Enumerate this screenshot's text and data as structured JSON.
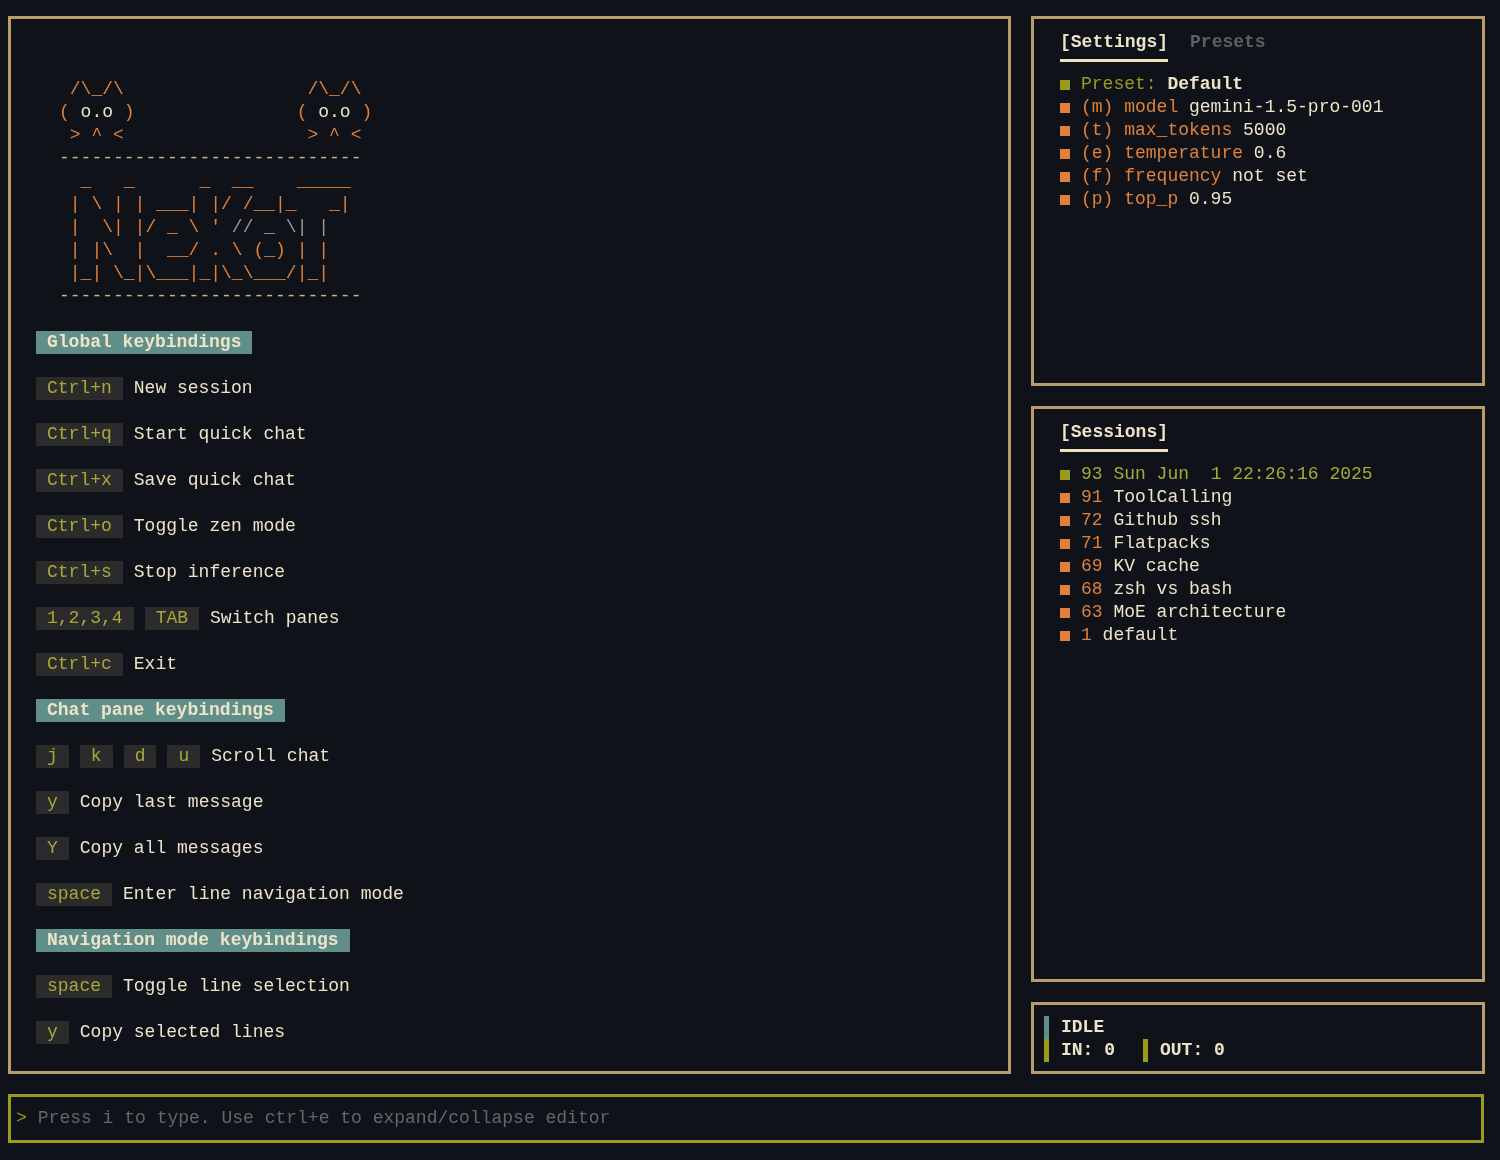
{
  "help_pane": {
    "art": {
      "color": "#e0803a",
      "lines": [
        {
          "segments": [
            {
              "text": " /\\_/\\                 /\\_/\\",
              "color": "#e0803a"
            }
          ]
        },
        {
          "segments": [
            {
              "text": "( ",
              "color": "#e0803a"
            },
            {
              "text": "o.o",
              "color": "#ece3c9"
            },
            {
              "text": " )               ( ",
              "color": "#e0803a"
            },
            {
              "text": "o.o",
              "color": "#ece3c9"
            },
            {
              "text": " )",
              "color": "#e0803a"
            }
          ]
        },
        {
          "segments": [
            {
              "text": " > ^ <                 > ^ <",
              "color": "#e0803a"
            }
          ]
        },
        {
          "segments": [
            {
              "text": "----------------------------",
              "color": "#c7b48a"
            }
          ]
        },
        {
          "segments": [
            {
              "text": "  _   _      _  __    _____"
            }
          ]
        },
        {
          "segments": [
            {
              "text": " | \\ | | ___| |/ /__|_   _|",
              "color": "#e0803a"
            }
          ]
        },
        {
          "segments": [
            {
              "text": " |  \\| |/ _ \\ ' ",
              "color": "#e0803a"
            },
            {
              "text": "// _ \\| |",
              "color": "#9a9a9a"
            }
          ]
        },
        {
          "segments": [
            {
              "text": " | |\\  |  __/ . \\ (_) | |",
              "color": "#e0803a"
            }
          ]
        },
        {
          "segments": [
            {
              "text": " |_| \\_|\\___|_|\\_\\___/|_|",
              "color": "#e0803a"
            }
          ]
        },
        {
          "segments": [
            {
              "text": "----------------------------",
              "color": "#c7b48a"
            }
          ]
        }
      ]
    },
    "sections": [
      {
        "title": "Global keybindings",
        "bindings": [
          {
            "keys": [
              "Ctrl+n"
            ],
            "action": "New session"
          },
          {
            "keys": [
              "Ctrl+q"
            ],
            "action": "Start quick chat"
          },
          {
            "keys": [
              "Ctrl+x"
            ],
            "action": "Save quick chat"
          },
          {
            "keys": [
              "Ctrl+o"
            ],
            "action": "Toggle zen mode"
          },
          {
            "keys": [
              "Ctrl+s"
            ],
            "action": "Stop inference"
          },
          {
            "keys": [
              "1,2,3,4",
              "TAB"
            ],
            "action": "Switch panes"
          },
          {
            "keys": [
              "Ctrl+c"
            ],
            "action": "Exit"
          }
        ]
      },
      {
        "title": "Chat pane keybindings",
        "bindings": [
          {
            "keys": [
              "j",
              "k",
              "d",
              "u"
            ],
            "action": "Scroll chat"
          },
          {
            "keys": [
              "y"
            ],
            "action": "Copy last message"
          },
          {
            "keys": [
              "Y"
            ],
            "action": "Copy all messages"
          },
          {
            "keys": [
              "space"
            ],
            "action": "Enter line navigation mode"
          }
        ]
      },
      {
        "title": "Navigation mode keybindings",
        "bindings": [
          {
            "keys": [
              "space"
            ],
            "action": "Toggle line selection"
          },
          {
            "keys": [
              "y"
            ],
            "action": "Copy selected lines"
          }
        ]
      }
    ]
  },
  "settings_pane": {
    "tabs": [
      {
        "label": "[Settings]",
        "selected": true
      },
      {
        "label": "Presets",
        "selected": false
      }
    ],
    "items": [
      {
        "kind": "preset",
        "label": "Preset:",
        "value": "Default"
      },
      {
        "kind": "setting",
        "shortcut": "(m)",
        "label": "model",
        "value": "gemini-1.5-pro-001"
      },
      {
        "kind": "setting",
        "shortcut": "(t)",
        "label": "max_tokens",
        "value": "5000"
      },
      {
        "kind": "setting",
        "shortcut": "(e)",
        "label": "temperature",
        "value": "0.6"
      },
      {
        "kind": "setting",
        "shortcut": "(f)",
        "label": "frequency",
        "value": "not set"
      },
      {
        "kind": "setting",
        "shortcut": "(p)",
        "label": "top_p",
        "value": "0.95"
      }
    ]
  },
  "sessions_pane": {
    "tabs": [
      {
        "label": "[Sessions]",
        "selected": true
      }
    ],
    "items": [
      {
        "id": "93",
        "name": "Sun Jun  1 22:26:16 2025",
        "selected": true
      },
      {
        "id": "91",
        "name": "ToolCalling",
        "selected": false
      },
      {
        "id": "72",
        "name": "Github ssh",
        "selected": false
      },
      {
        "id": "71",
        "name": "Flatpacks",
        "selected": false
      },
      {
        "id": "69",
        "name": "KV cache",
        "selected": false
      },
      {
        "id": "68",
        "name": "zsh vs bash",
        "selected": false
      },
      {
        "id": "63",
        "name": "MoE architecture",
        "selected": false
      },
      {
        "id": "1",
        "name": "default",
        "selected": false
      }
    ]
  },
  "status": {
    "state": "IDLE",
    "in": "IN: 0",
    "out": "OUT: 0"
  },
  "prompt": {
    "marker": ">",
    "placeholder": "Press i to type. Use ctrl+e to expand/collapse editor"
  }
}
